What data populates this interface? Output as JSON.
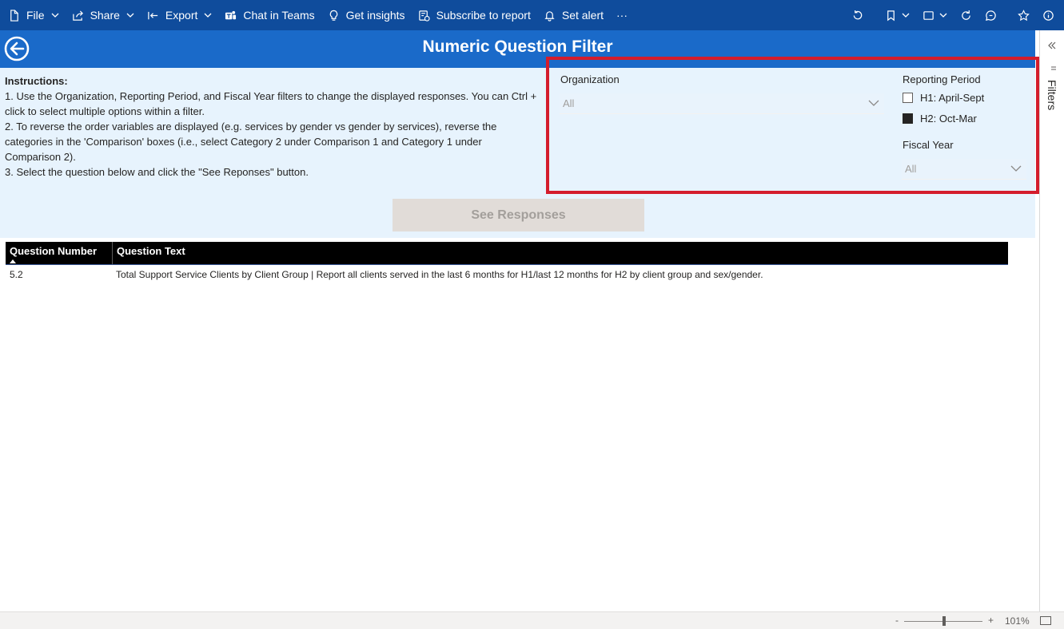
{
  "toolbar": {
    "file_label": "File",
    "share_label": "Share",
    "export_label": "Export",
    "chat_label": "Chat in Teams",
    "insights_label": "Get insights",
    "subscribe_label": "Subscribe to report",
    "alert_label": "Set alert",
    "more_label": "···"
  },
  "page": {
    "title": "Numeric Question Filter"
  },
  "instructions": {
    "heading": "Instructions:",
    "lines": [
      "1. Use the Organization, Reporting Period, and Fiscal Year filters to change the displayed responses. You can Ctrl + click to select multiple options within a filter.",
      "2. To reverse the order variables are displayed (e.g. services by gender vs gender by services), reverse the categories in the 'Comparison' boxes (i.e., select Category 2 under Comparison 1 and Category 1 under Comparison 2).",
      "3. Select the question below and click the \"See Reponses\" button."
    ]
  },
  "filters": {
    "organization": {
      "title": "Organization",
      "value": "All"
    },
    "reporting_period": {
      "title": "Reporting Period",
      "options": [
        {
          "label": "H1: April-Sept",
          "checked": false
        },
        {
          "label": "H2: Oct-Mar",
          "checked": true
        }
      ]
    },
    "fiscal_year": {
      "title": "Fiscal Year",
      "value": "All"
    }
  },
  "see_responses_label": "See Responses",
  "table": {
    "headers": [
      "Question Number",
      "Question Text"
    ],
    "rows": [
      [
        "5.2",
        "Total Support Service Clients by Client Group | Report all clients served in the last 6 months for H1/last 12 months for H2 by client group and sex/gender."
      ]
    ]
  },
  "filters_pane": {
    "label": "Filters"
  },
  "status": {
    "zoom_minus": "-",
    "zoom_plus": "+",
    "zoom_level": "101%"
  },
  "colors": {
    "toolbar": "#0f4c9c",
    "banner": "#1a6ac9",
    "panel": "#e7f3fd",
    "highlight_border": "#d41c2c"
  }
}
